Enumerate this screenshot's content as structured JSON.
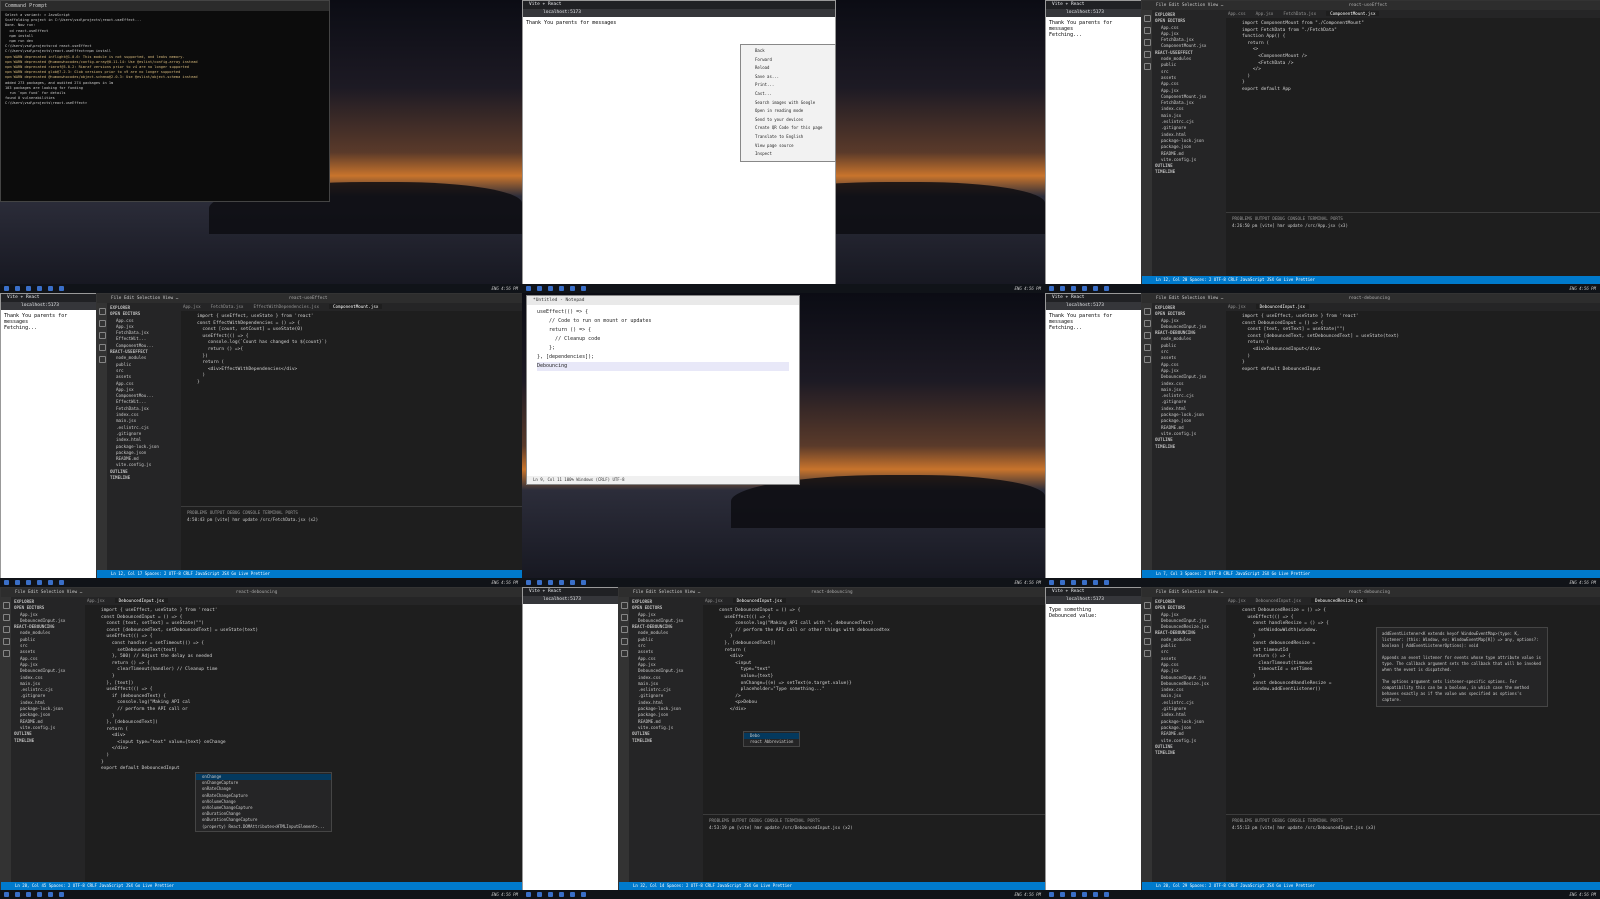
{
  "cells": [
    {
      "id": "r1c1",
      "cmd": {
        "title": "Command Prompt",
        "lines": [
          "Select a variant: » JavaScript",
          "",
          "Scaffolding project in C:\\Users\\vsd\\projects\\react-useEffect...",
          "",
          "Done. Now run:",
          "",
          "  cd react-useEffect",
          "  npm install",
          "  npm run dev",
          "",
          "C:\\Users\\vsd\\projects>cd react-useEffect",
          "",
          "C:\\Users\\vsd\\projects\\react-useEffect>npm install",
          "npm WARN deprecated inflight@1.0.6: This module is not supported, and leaks memory.",
          "npm WARN deprecated @humanwhocodes/config-array@0.11.14: Use @eslint/config-array instead",
          "npm WARN deprecated rimraf@3.0.2: Rimraf versions prior to v4 are no longer supported",
          "npm WARN deprecated glob@7.2.3: Glob versions prior to v9 are no longer supported",
          "npm WARN deprecated @humanwhocodes/object-schema@2.0.3: Use @eslint/object-schema instead",
          "",
          "added 273 packages, and audited 274 packages in 1m",
          "",
          "103 packages are looking for funding",
          "  run `npm fund` for details",
          "",
          "found 0 vulnerabilities",
          "",
          "C:\\Users\\vsd\\projects\\react-useEffect>"
        ]
      }
    },
    {
      "id": "r1c2",
      "browser": {
        "tab": "Vite + React",
        "url": "localhost:5173",
        "page": "Thank You parents for messages"
      },
      "menu": [
        "Back",
        "Forward",
        "Reload",
        "Save as...",
        "Print...",
        "Cast...",
        "Search images with Google",
        "Open in reading mode",
        "Send to your devices",
        "Create QR Code for this page",
        "Translate to English",
        "View page source",
        "Inspect"
      ]
    },
    {
      "id": "r1c3",
      "browser": {
        "tab": "Vite + React",
        "url": "localhost:5173",
        "page": "Thank You parents for messages\nFetching..."
      },
      "vscode": {
        "title": "react-useEffect",
        "tabs": [
          "App.css",
          "App.jsx",
          "FetchData.jsx",
          "ComponentMount.jsx"
        ],
        "explorer": [
          "OPEN EDITORS",
          "App.css",
          "App.jsx",
          "FetchData.jsx",
          "ComponentMount.jsx",
          "REACT-USEEFFECT",
          "node_modules",
          "public",
          "src",
          "assets",
          "App.css",
          "App.jsx",
          "ComponentMount.jsx",
          "FetchData.jsx",
          "index.css",
          "main.jsx",
          ".eslintrc.cjs",
          ".gitignore",
          "index.html",
          "package-lock.json",
          "package.json",
          "README.md",
          "vite.config.js",
          "OUTLINE",
          "TIMELINE"
        ],
        "code": [
          "import ComponentMount from \"./ComponentMount\"",
          "import FetchData from \"./FetchData\"",
          "",
          "function App() {",
          "  return (",
          "    <>",
          "      <ComponentMount />",
          "      <FetchData />",
          "    </>",
          "  )",
          "}",
          "",
          "export default App"
        ],
        "panel_tabs": "PROBLEMS   OUTPUT   DEBUG CONSOLE   TERMINAL   PORTS",
        "panel_line": "4:26:50 pm [vite] hmr update /src/App.jsx (x3)",
        "status": "Ln 12, Col 20   Spaces: 2   UTF-8   CRLF   JavaScript JSX   Go Live   Prettier"
      }
    },
    {
      "id": "r2c1",
      "browser": {
        "tab": "Vite + React",
        "url": "localhost:5173",
        "page": "Thank You parents for messages\nFetching..."
      },
      "vscode": {
        "title": "react-useEffect",
        "tabs": [
          "App.jsx",
          "FetchData.jsx",
          "EffectWithDependencies.jsx",
          "ComponentMount.jsx"
        ],
        "explorer": [
          "OPEN EDITORS",
          "App.css",
          "App.jsx",
          "FetchData.jsx",
          "EffectWit...",
          "ComponentMou...",
          "REACT-USEEFFECT",
          "node_modules",
          "public",
          "src",
          "assets",
          "App.css",
          "App.jsx",
          "ComponentMou...",
          "EffectWit...",
          "FetchData.jsx",
          "index.css",
          "main.jsx",
          ".eslintrc.cjs",
          ".gitignore",
          "index.html",
          "package-lock.json",
          "package.json",
          "README.md",
          "vite.config.js",
          "OUTLINE",
          "TIMELINE"
        ],
        "code": [
          "import { useEffect, useState } from 'react'",
          "",
          "const EffectWithDependencies = () => {",
          "",
          "  const [count, setCount] = useState(0)",
          "",
          "  useEffect(() => {",
          "    console.log(`Count has changed to ${count}`)",
          "",
          "    return () =>{",
          "  })",
          "",
          "",
          "  return (",
          "    <div>EffectWithDependencies</div>",
          "  )",
          "}"
        ],
        "panel_tabs": "PROBLEMS   OUTPUT   DEBUG CONSOLE   TERMINAL   PORTS",
        "panel_line": "4:50:43 pm [vite] hmr update /src/FetchData.jsx (x2)",
        "status": "Ln 12, Col 17   Spaces: 2   UTF-8   CRLF   JavaScript JSX   Go Live   Prettier"
      }
    },
    {
      "id": "r2c2",
      "notepad": {
        "title": "*Untitled - Notepad",
        "lines": [
          "useEffect(() => {",
          "    // Code to run on mount or updates",
          "",
          "    return () => {",
          "      // Cleanup code",
          "    };",
          "}, [dependencies]);",
          "",
          "Debouncing"
        ],
        "status": "Ln 9, Col 11   100%   Windows (CRLF)   UTF-8"
      }
    },
    {
      "id": "r2c3",
      "browser": {
        "tab": "Vite + React",
        "url": "localhost:5173",
        "page": "Thank You parents for messages\nFetching..."
      },
      "vscode": {
        "title": "react-debouncing",
        "tabs": [
          "App.jsx",
          "DebouncedInput.jsx"
        ],
        "explorer": [
          "OPEN EDITORS",
          "App.jsx",
          "DebouncedInput.jsx",
          "REACT-DEBOUNCING",
          "node_modules",
          "public",
          "src",
          "assets",
          "App.css",
          "App.jsx",
          "DebouncedInput.jsx",
          "index.css",
          "main.jsx",
          ".eslintrc.cjs",
          ".gitignore",
          "index.html",
          "package-lock.json",
          "package.json",
          "README.md",
          "vite.config.js",
          "OUTLINE",
          "TIMELINE"
        ],
        "code": [
          "import { useEffect, useState } from 'react'",
          "",
          "const DebouncedInput = () => {",
          "  const [text, setText] = useState(\"\")",
          "  const [debouncedText, setDebouncedText] = useState(text)",
          "",
          "",
          "",
          "",
          "  return (",
          "    <div>DebouncedInput</div>",
          "  )",
          "}",
          "",
          "export default DebouncedInput"
        ],
        "status": "Ln 7, Col 3   Spaces: 2   UTF-8   CRLF   JavaScript JSX   Go Live   Prettier"
      }
    },
    {
      "id": "r3c1",
      "vscode": {
        "title": "react-debouncing",
        "tabs": [
          "App.jsx",
          "DebouncedInput.jsx"
        ],
        "explorer": [
          "OPEN EDITORS",
          "App.jsx",
          "DebouncedInput.jsx",
          "REACT-DEBOUNCING",
          "node_modules",
          "public",
          "src",
          "assets",
          "App.css",
          "App.jsx",
          "DebouncedInput.jsx",
          "index.css",
          "main.jsx",
          ".eslintrc.cjs",
          ".gitignore",
          "index.html",
          "package-lock.json",
          "package.json",
          "README.md",
          "vite.config.js",
          "OUTLINE",
          "TIMELINE"
        ],
        "code": [
          "import { useEffect, useState } from 'react'",
          "",
          "const DebouncedInput = () => {",
          "  const [text, setText] = useState(\"\")",
          "  const [debouncedText, setDebouncedText] = useState(text)",
          "",
          "  useEffect(() => {",
          "    const handler = setTimeout(() => {",
          "      setDebouncedText(text)",
          "    }, 500) // Adjust the delay as needed",
          "",
          "    return () => {",
          "      clearTimeout(handler) // Cleanup time",
          "    }",
          "  }, [text])",
          "",
          "  useEffect(() => {",
          "    if (debouncedText) {",
          "      console.log(\"Making API cal",
          "      // perform the API call or",
          "    }",
          "  }, [debouncedText])",
          "",
          "  return (",
          "    <div>",
          "      <input type=\"text\" value={text} onChange",
          "    </div>",
          "  )",
          "}",
          "",
          "export default DebouncedInput"
        ],
        "suggest": [
          "onChange",
          "onChangeCapture",
          "onRateChange",
          "onRateChangeCapture",
          "onVolumeChange",
          "onVolumeChangeCapture",
          "onDurationChange",
          "onDurationChangeCapture"
        ],
        "suggest_detail": "(property) React.DOMAttributes<HTMLInputElement>...",
        "status": "Ln 28, Col 45   Spaces: 2   UTF-8   CRLF   JavaScript JSX   Go Live   Prettier"
      }
    },
    {
      "id": "r3c2",
      "browser": {
        "tab": "Vite + React",
        "url": "localhost:5173",
        "page": ""
      },
      "vscode": {
        "title": "react-debouncing",
        "tabs": [
          "App.jsx",
          "DebouncedInput.jsx"
        ],
        "explorer": [
          "OPEN EDITORS",
          "App.jsx",
          "DebouncedInput.jsx",
          "REACT-DEBOUNCING",
          "node_modules",
          "public",
          "src",
          "assets",
          "App.css",
          "App.jsx",
          "DebouncedInput.jsx",
          "index.css",
          "main.jsx",
          ".eslintrc.cjs",
          ".gitignore",
          "index.html",
          "package-lock.json",
          "package.json",
          "README.md",
          "vite.config.js",
          "OUTLINE",
          "TIMELINE"
        ],
        "code": [
          "const DebouncedInput = () => {",
          "  useEffect(() => {",
          "      console.log(\"Making API call with \", debouncedText)",
          "      // perform the API call or other things with debouncedtex",
          "    }",
          "  }, [debouncedText])",
          "",
          "  return (",
          "    <div>",
          "      <input",
          "        type=\"text\"",
          "        value={text}",
          "        onChange={(e) => setText(e.target.value)}",
          "        placeholder=\"Type something...\"",
          "      />",
          "      <p>Debou",
          "    </div>"
        ],
        "suggest": [
          "Debo",
          "react Abbreviation"
        ],
        "panel_tabs": "PROBLEMS   OUTPUT   DEBUG CONSOLE   TERMINAL   PORTS",
        "panel_line": "4:53:19 pm [vite] hmr update /src/DebouncedInput.jsx (x2)",
        "status": "Ln 32, Col 14   Spaces: 2   UTF-8   CRLF   JavaScript JSX   Go Live   Prettier"
      }
    },
    {
      "id": "r3c3",
      "browser": {
        "tab": "Vite + React",
        "url": "localhost:5173",
        "page": "Type something\nDebounced value:"
      },
      "vscode": {
        "title": "react-debouncing",
        "tabs": [
          "App.jsx",
          "DebouncedInput.jsx",
          "DebouncedResize.jsx"
        ],
        "explorer": [
          "OPEN EDITORS",
          "App.jsx",
          "DebouncedInput.jsx",
          "DebouncedResize.jsx",
          "REACT-DEBOUNCING",
          "node_modules",
          "public",
          "src",
          "assets",
          "App.css",
          "App.jsx",
          "DebouncedInput.jsx",
          "DebouncedResize.jsx",
          "index.css",
          "main.jsx",
          ".eslintrc.cjs",
          ".gitignore",
          "index.html",
          "package-lock.json",
          "package.json",
          "README.md",
          "vite.config.js",
          "OUTLINE",
          "TIMELINE"
        ],
        "code": [
          "const DebouncedResize = () => {",
          "  useEffect(() => {",
          "    const handleResize = () => {",
          "      setWindowWidth(window.",
          "    }",
          "",
          "    const debouncedResize =",
          "    let timeoutId",
          "    return () => {",
          "      clearTimeout(timeout",
          "      timeoutId = setTimeo",
          "    }",
          "",
          "    const debouncedHandleResize =",
          "    window.addEventListener()"
        ],
        "hover": "addEventListener<K extends keyof WindowEventMap>(type: K, listener: (this: Window, ev: WindowEventMap[K]) => any, options?: boolean | AddEventListenerOptions): void\n\nAppends an event listener for events whose type attribute value is type. The callback argument sets the callback that will be invoked when the event is dispatched.\n\nThe options argument sets listener-specific options. For compatibility this can be a boolean, in which case the method behaves exactly as if the value was specified as options's capture.",
        "panel_tabs": "PROBLEMS   OUTPUT   DEBUG CONSOLE   TERMINAL   PORTS",
        "panel_line": "4:55:13 pm [vite] hmr update /src/DebouncedInput.jsx (x3)",
        "status": "Ln 20, Col 29   Spaces: 2   UTF-8   CRLF   JavaScript JSX   Go Live   Prettier"
      }
    }
  ],
  "taskbar": {
    "clock": "ENG  4:56 PM"
  }
}
